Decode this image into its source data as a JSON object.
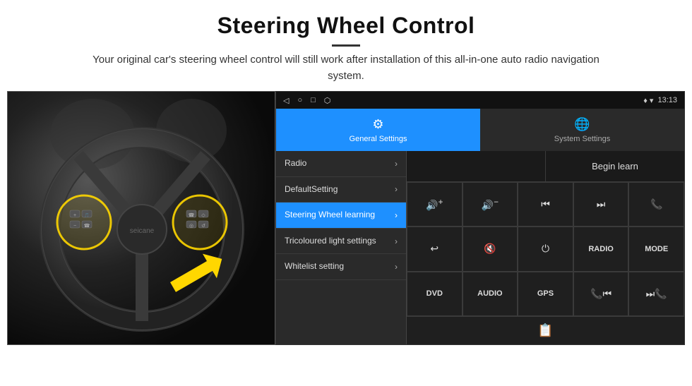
{
  "header": {
    "title": "Steering Wheel Control",
    "description": "Your original car's steering wheel control will still work after installation of this all-in-one auto radio navigation system."
  },
  "status_bar": {
    "time": "13:13",
    "nav_back": "◁",
    "nav_home": "○",
    "nav_recent": "□",
    "nav_cast": "⬡",
    "signal_icon": "♦",
    "wifi_icon": "▾"
  },
  "tabs": [
    {
      "label": "General Settings",
      "icon": "⚙",
      "active": true
    },
    {
      "label": "System Settings",
      "icon": "🌐",
      "active": false
    }
  ],
  "menu_items": [
    {
      "label": "Radio",
      "active": false
    },
    {
      "label": "DefaultSetting",
      "active": false
    },
    {
      "label": "Steering Wheel learning",
      "active": true
    },
    {
      "label": "Tricoloured light settings",
      "active": false
    },
    {
      "label": "Whitelist setting",
      "active": false
    }
  ],
  "controls": {
    "begin_learn_label": "Begin learn",
    "buttons": [
      {
        "icon": "🔊+",
        "type": "icon"
      },
      {
        "icon": "🔊−",
        "type": "icon"
      },
      {
        "icon": "⏮",
        "type": "icon"
      },
      {
        "icon": "⏭",
        "type": "icon"
      },
      {
        "icon": "📞",
        "type": "icon"
      },
      {
        "icon": "↩",
        "type": "icon"
      },
      {
        "icon": "🔇",
        "type": "icon"
      },
      {
        "icon": "⏻",
        "type": "icon"
      },
      {
        "label": "RADIO",
        "type": "text"
      },
      {
        "label": "MODE",
        "type": "text"
      },
      {
        "label": "DVD",
        "type": "text"
      },
      {
        "label": "AUDIO",
        "type": "text"
      },
      {
        "label": "GPS",
        "type": "text"
      },
      {
        "icon": "📞⏮",
        "type": "icon"
      },
      {
        "icon": "⏭📞",
        "type": "icon"
      }
    ]
  }
}
